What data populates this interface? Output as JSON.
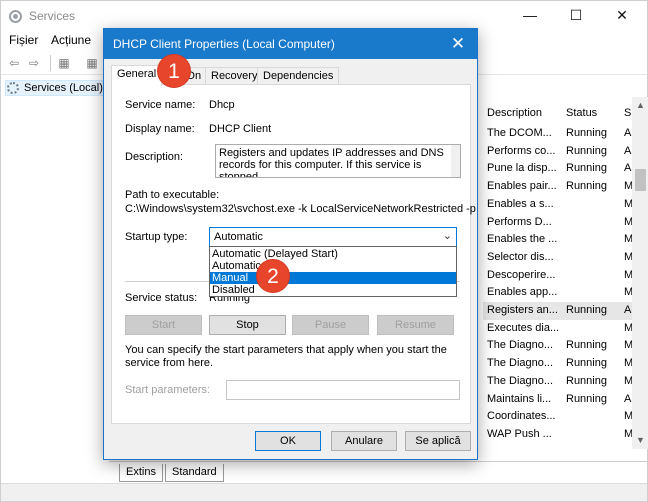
{
  "app": {
    "title": "Services",
    "min_glyph": "—",
    "max_glyph": "☐",
    "close_glyph": "✕"
  },
  "menu": [
    "Fișier",
    "Acțiune"
  ],
  "toolbar": {
    "back_glyph": "⇦",
    "forward_glyph": "⇨",
    "icon_glyph": "▦"
  },
  "tree": {
    "item": "Services (Local)"
  },
  "list": {
    "columns": [
      "Description",
      "Status",
      "S"
    ],
    "rows": [
      {
        "desc": "The DCOM...",
        "status": "Running",
        "st": "A"
      },
      {
        "desc": "Performs co...",
        "status": "Running",
        "st": "A"
      },
      {
        "desc": "Pune la disp...",
        "status": "Running",
        "st": "A"
      },
      {
        "desc": "Enables pair...",
        "status": "Running",
        "st": "M"
      },
      {
        "desc": "Enables a s...",
        "status": "",
        "st": "M"
      },
      {
        "desc": "Performs D...",
        "status": "",
        "st": "M"
      },
      {
        "desc": "Enables the ...",
        "status": "",
        "st": "M"
      },
      {
        "desc": "Selector dis...",
        "status": "",
        "st": "M"
      },
      {
        "desc": "Descoperire...",
        "status": "",
        "st": "M"
      },
      {
        "desc": "Enables app...",
        "status": "",
        "st": "M"
      },
      {
        "desc": "Registers an...",
        "status": "Running",
        "st": "A"
      },
      {
        "desc": "Executes dia...",
        "status": "",
        "st": "M"
      },
      {
        "desc": "The Diagno...",
        "status": "Running",
        "st": "M"
      },
      {
        "desc": "The Diagno...",
        "status": "Running",
        "st": "M"
      },
      {
        "desc": "The Diagno...",
        "status": "Running",
        "st": "M"
      },
      {
        "desc": "Maintains li...",
        "status": "Running",
        "st": "A"
      },
      {
        "desc": "Coordinates...",
        "status": "",
        "st": "M"
      },
      {
        "desc": "WAP Push ...",
        "status": "",
        "st": "M"
      }
    ],
    "selected_index": 10,
    "scroll_up": "▲",
    "scroll_down": "▼"
  },
  "bottom_tabs": [
    "Extins",
    "Standard"
  ],
  "dialog": {
    "title": "DHCP Client Properties (Local Computer)",
    "close_glyph": "✕",
    "tabs": [
      "General",
      "Log On",
      "Recovery",
      "Dependencies"
    ],
    "active_tab": "General",
    "service_name_label": "Service name:",
    "service_name": "Dhcp",
    "display_name_label": "Display name:",
    "display_name": "DHCP Client",
    "description_label": "Description:",
    "description": "Registers and updates IP addresses and DNS records for this computer. If this service is stopped,",
    "path_label": "Path to executable:",
    "path": "C:\\Windows\\system32\\svchost.exe -k LocalServiceNetworkRestricted -p",
    "startup_label": "Startup type:",
    "startup_value": "Automatic",
    "startup_arrow": "⌄",
    "startup_options": [
      "Automatic (Delayed Start)",
      "Automatic",
      "Manual",
      "Disabled"
    ],
    "highlighted_option": "Manual",
    "status_label": "Service status:",
    "status_value": "Running",
    "buttons": {
      "start": "Start",
      "stop": "Stop",
      "pause": "Pause",
      "resume": "Resume"
    },
    "note": "You can specify the start parameters that apply when you start the service from here.",
    "params_label": "Start parameters:",
    "params_value": "",
    "ok": "OK",
    "cancel": "Anulare",
    "apply": "Se aplică"
  },
  "callouts": [
    "1",
    "2"
  ],
  "colors": {
    "dialog_title_bg": "#1979ca",
    "highlight": "#0078d7",
    "callout": "#e8462c"
  }
}
